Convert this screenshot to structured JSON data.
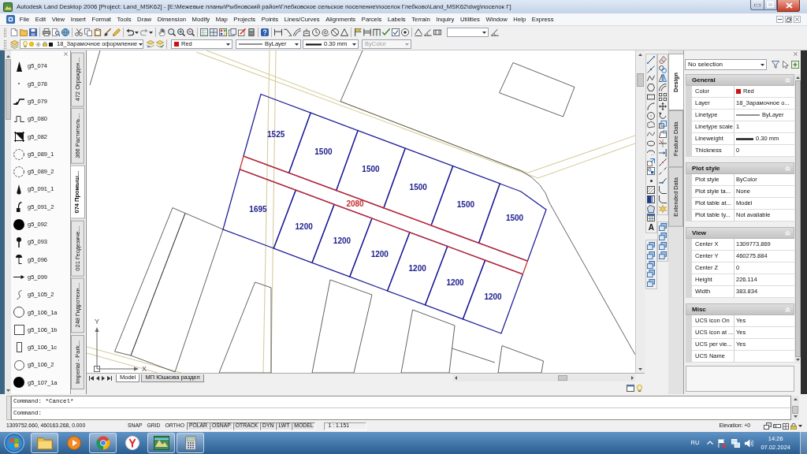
{
  "window": {
    "title": "Autodesk Land Desktop 2006 [Project: Land_MSK62] - [E:\\Межевые планы\\Рыбновский район\\Глебковское сельское поселение\\поселок Глебково\\Land_MSK62\\dwg\\поселок Г]"
  },
  "menu": [
    "File",
    "Edit",
    "View",
    "Insert",
    "Format",
    "Tools",
    "Draw",
    "Dimension",
    "Modify",
    "Map",
    "Projects",
    "Points",
    "Lines/Curves",
    "Alignments",
    "Parcels",
    "Labels",
    "Terrain",
    "Inquiry",
    "Utilities",
    "Window",
    "Help",
    "Express"
  ],
  "object_properties_toolbar": {
    "layer": "18_Зарамочное оформление",
    "color_name": "Red",
    "color": "#cc1111",
    "linetype": "ByLayer",
    "lineweight": "0.30 mm",
    "plot_style": "ByColor",
    "plot_style_disabled": true
  },
  "tool_palette": {
    "items": [
      "g5_074",
      "g5_078",
      "g5_079",
      "g5_080",
      "g5_082",
      "g5_089_1",
      "g5_089_2",
      "g5_091_1",
      "g5_091_2",
      "g5_092",
      "g5_093",
      "g5_096",
      "g5_099",
      "g5_105_2",
      "g5_106_1a",
      "g5_106_1b",
      "g5_106_1c",
      "g5_106_2",
      "g5_107_1a"
    ],
    "tabs": [
      {
        "label": "472 Огражден...",
        "selected": false
      },
      {
        "label": "366 Раститель...",
        "selected": false
      },
      {
        "label": "074 Промыш...",
        "selected": true
      },
      {
        "label": "001 Геодезиче...",
        "selected": false
      },
      {
        "label": "248 Гидротехн...",
        "selected": false
      },
      {
        "label": "Imperial - Park...",
        "selected": false
      }
    ]
  },
  "drawing": {
    "north_parcels": [
      "1525",
      "1500",
      "1500",
      "1500",
      "1500",
      "1500"
    ],
    "south_parcels": [
      "1695",
      "1200",
      "1200",
      "1200",
      "1200",
      "1200",
      "1200"
    ],
    "road": "2080",
    "ucs": {
      "y": "Y",
      "x": "X"
    }
  },
  "layout_tabs": [
    {
      "label": "Model",
      "selected": true
    },
    {
      "label": "МП Юшкова раздел",
      "selected": false
    }
  ],
  "draw_toolbar": {
    "text_tool": "A"
  },
  "properties": {
    "tabs": [
      {
        "label": "Design",
        "selected": true
      },
      {
        "label": "Feature Data",
        "selected": false
      },
      {
        "label": "Extended Data",
        "selected": false
      }
    ],
    "selection": "No selection",
    "sections": [
      {
        "title": "General",
        "rows": [
          {
            "label": "Color",
            "value": "Red",
            "kind": "color",
            "color": "#cc1111"
          },
          {
            "label": "Layer",
            "value": "18_Зарамочное о...",
            "kind": "text"
          },
          {
            "label": "Linetype",
            "value": "ByLayer",
            "kind": "linetype"
          },
          {
            "label": "Linetype scale",
            "value": "1",
            "kind": "text"
          },
          {
            "label": "Lineweight",
            "value": "0.30 mm",
            "kind": "lineweight"
          },
          {
            "label": "Thickness",
            "value": "0",
            "kind": "text"
          }
        ]
      },
      {
        "title": "Plot style",
        "rows": [
          {
            "label": "Plot style",
            "value": "ByColor",
            "kind": "text"
          },
          {
            "label": "Plot style ta...",
            "value": "None",
            "kind": "text"
          },
          {
            "label": "Plot table at...",
            "value": "Model",
            "kind": "text"
          },
          {
            "label": "Plot table ty...",
            "value": "Not available",
            "kind": "text"
          }
        ]
      },
      {
        "title": "View",
        "rows": [
          {
            "label": "Center X",
            "value": "1309773.869",
            "kind": "text"
          },
          {
            "label": "Center Y",
            "value": "460275.884",
            "kind": "text"
          },
          {
            "label": "Center Z",
            "value": "0",
            "kind": "text"
          },
          {
            "label": "Height",
            "value": "226.114",
            "kind": "text"
          },
          {
            "label": "Width",
            "value": "383.834",
            "kind": "text"
          }
        ]
      },
      {
        "title": "Misc",
        "rows": [
          {
            "label": "UCS icon On",
            "value": "Yes",
            "kind": "text"
          },
          {
            "label": "UCS icon at ...",
            "value": "Yes",
            "kind": "text"
          },
          {
            "label": "UCS per vie...",
            "value": "Yes",
            "kind": "text"
          },
          {
            "label": "UCS Name",
            "kind": "text"
          }
        ]
      }
    ]
  },
  "command_line": {
    "history": "Command: *Cancel*",
    "prompt": "Command:"
  },
  "status_bar": {
    "coordinates": "1309752.660, 460163.268, 0.000",
    "toggles": [
      {
        "label": "SNAP",
        "on": false
      },
      {
        "label": "GRID",
        "on": false
      },
      {
        "label": "ORTHO",
        "on": false
      },
      {
        "label": "POLAR",
        "on": true
      },
      {
        "label": "OSNAP",
        "on": true
      },
      {
        "label": "OTRACK",
        "on": true
      },
      {
        "label": "DYN",
        "on": true
      },
      {
        "label": "LWT",
        "on": true
      },
      {
        "label": "MODEL",
        "on": true
      }
    ],
    "scale": "1 : 1.151",
    "elevation": "Elevation: +0"
  },
  "taskbar": {
    "apps": [
      {
        "running": true
      },
      {
        "running": false
      },
      {
        "running": true
      },
      {
        "running": false
      },
      {
        "running": true
      },
      {
        "running": true
      }
    ],
    "language": "RU",
    "time": "14:26",
    "date": "07.02.2024"
  }
}
